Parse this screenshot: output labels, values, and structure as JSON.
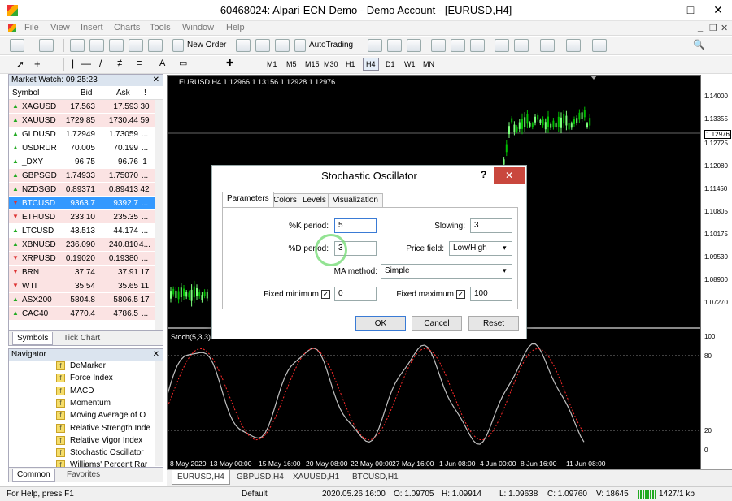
{
  "window": {
    "title": "60468024: Alpari-ECN-Demo - Demo Account - [EURUSD,H4]",
    "minimize": "—",
    "maximize": "□",
    "close": "✕"
  },
  "menu": [
    "File",
    "View",
    "Insert",
    "Charts",
    "Tools",
    "Window",
    "Help"
  ],
  "toolbar": {
    "new_order": "New Order",
    "autotrading": "AutoTrading",
    "timeframes": [
      "M1",
      "M5",
      "M15",
      "M30",
      "H1",
      "H4",
      "D1",
      "W1",
      "MN"
    ]
  },
  "market_watch": {
    "title": "Market Watch: 09:25:23",
    "columns": [
      "Symbol",
      "Bid",
      "Ask",
      "!"
    ],
    "rows": [
      {
        "symbol": "XAGUSD",
        "bid": "17.563",
        "ask": "17.593",
        "spread": "30",
        "dir": "up",
        "bg": "#fbe3e3"
      },
      {
        "symbol": "XAUUSD",
        "bid": "1729.85",
        "ask": "1730.44",
        "spread": "59",
        "dir": "up",
        "bg": "#fbe3e3"
      },
      {
        "symbol": "GLDUSD",
        "bid": "1.72949",
        "ask": "1.73059",
        "spread": "...",
        "dir": "up",
        "bg": "#fff"
      },
      {
        "symbol": "USDRUR",
        "bid": "70.005",
        "ask": "70.199",
        "spread": "...",
        "dir": "up",
        "bg": "#fff"
      },
      {
        "symbol": "_DXY",
        "bid": "96.75",
        "ask": "96.76",
        "spread": "1",
        "dir": "up",
        "bg": "#fff"
      },
      {
        "symbol": "GBPSGD",
        "bid": "1.74933",
        "ask": "1.75070",
        "spread": "...",
        "dir": "up",
        "bg": "#fbe3e3"
      },
      {
        "symbol": "NZDSGD",
        "bid": "0.89371",
        "ask": "0.89413",
        "spread": "42",
        "dir": "up",
        "bg": "#fbe3e3"
      },
      {
        "symbol": "BTCUSD",
        "bid": "9363.7",
        "ask": "9392.7",
        "spread": "...",
        "dir": "down",
        "bg": "#3399ff"
      },
      {
        "symbol": "ETHUSD",
        "bid": "233.10",
        "ask": "235.35",
        "spread": "...",
        "dir": "down",
        "bg": "#fbe3e3"
      },
      {
        "symbol": "LTCUSD",
        "bid": "43.513",
        "ask": "44.174",
        "spread": "...",
        "dir": "up",
        "bg": "#fff"
      },
      {
        "symbol": "XBNUSD",
        "bid": "236.090",
        "ask": "240.810",
        "spread": "4...",
        "dir": "up",
        "bg": "#fbe3e3"
      },
      {
        "symbol": "XRPUSD",
        "bid": "0.19020",
        "ask": "0.19380",
        "spread": "...",
        "dir": "down",
        "bg": "#fbe3e3"
      },
      {
        "symbol": "BRN",
        "bid": "37.74",
        "ask": "37.91",
        "spread": "17",
        "dir": "down",
        "bg": "#fbe3e3"
      },
      {
        "symbol": "WTI",
        "bid": "35.54",
        "ask": "35.65",
        "spread": "11",
        "dir": "down",
        "bg": "#fbe3e3"
      },
      {
        "symbol": "ASX200",
        "bid": "5804.8",
        "ask": "5806.5",
        "spread": "17",
        "dir": "up",
        "bg": "#fbe3e3"
      },
      {
        "symbol": "CAC40",
        "bid": "4770.4",
        "ask": "4786.5",
        "spread": "...",
        "dir": "up",
        "bg": "#fbe3e3"
      }
    ],
    "tabs": [
      "Symbols",
      "Tick Chart"
    ]
  },
  "navigator": {
    "title": "Navigator",
    "items": [
      "DeMarker",
      "Force Index",
      "MACD",
      "Momentum",
      "Moving Average of O",
      "Relative Strength Inde",
      "Relative Vigor Index",
      "Stochastic Oscillator",
      "Williams' Percent Rar"
    ],
    "tabs": [
      "Common",
      "Favorites"
    ]
  },
  "chart": {
    "header": "EURUSD,H4  1.12966 1.13156 1.12928 1.12976",
    "price_labels": [
      "1.14000",
      "1.13355",
      "1.12976",
      "1.12725",
      "1.12080",
      "1.11450",
      "1.10805",
      "1.10175",
      "1.09530",
      "1.08900",
      "1.07270"
    ],
    "indicator_title": "Stoch(5,3,3) 1",
    "indicator_labels": [
      "100",
      "80",
      "20",
      "0"
    ],
    "dates": [
      "8 May 2020",
      "13 May 00:00",
      "15 May 16:00",
      "20 May 08:00",
      "22 May 00:00",
      "27 May 16:00",
      "1 Jun 08:00",
      "4 Jun 00:00",
      "8 Jun 16:00",
      "11 Jun 08:00"
    ],
    "tabs": [
      "EURUSD,H4",
      "GBPUSD,H4",
      "XAUUSD,H1",
      "BTCUSD,H1"
    ]
  },
  "dialog": {
    "title": "Stochastic Oscillator",
    "help": "?",
    "tabs": [
      "Parameters",
      "Colors",
      "Levels",
      "Visualization"
    ],
    "k_label": "%K period:",
    "k_value": "5",
    "d_label": "%D period:",
    "d_value": "3",
    "slowing_label": "Slowing:",
    "slowing_value": "3",
    "price_label": "Price field:",
    "price_value": "Low/High",
    "ma_label": "MA method:",
    "ma_value": "Simple",
    "fmin_label": "Fixed minimum",
    "fmin_value": "0",
    "fmax_label": "Fixed maximum",
    "fmax_value": "100",
    "ok": "OK",
    "cancel": "Cancel",
    "reset": "Reset"
  },
  "status": {
    "help": "For Help, press F1",
    "profile": "Default",
    "datetime": "2020.05.26 16:00",
    "open": "O: 1.09705",
    "high": "H: 1.09914",
    "low": "L: 1.09638",
    "close": "C: 1.09760",
    "volume": "V: 18645",
    "traffic": "1427/1 kb"
  },
  "colors": {
    "bull": "#00c000",
    "bear": "#7cff7c",
    "main_line": "#c0c0c0",
    "signal": "#ff2a2a"
  }
}
